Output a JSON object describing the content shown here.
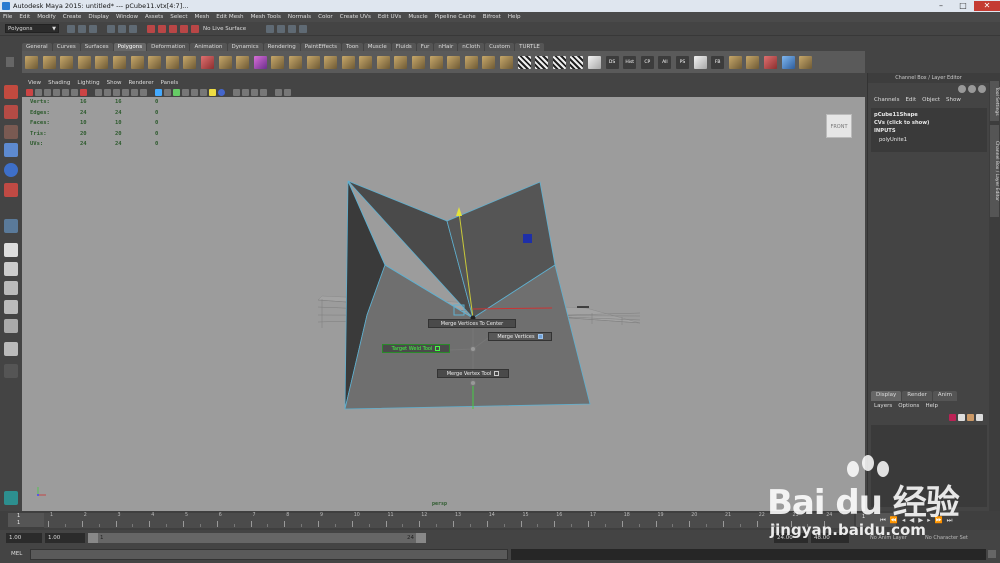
{
  "window": {
    "title": "Autodesk Maya 2015: untitled*   ---   pCube11.vtx[4:7]..."
  },
  "menubar": {
    "items": [
      "File",
      "Edit",
      "Modify",
      "Create",
      "Display",
      "Window",
      "Assets",
      "Select",
      "Mesh",
      "Edit Mesh",
      "Mesh Tools",
      "Normals",
      "Color",
      "Create UVs",
      "Edit UVs",
      "Muscle",
      "Pipeline Cache",
      "Bifrost",
      "Help"
    ]
  },
  "statusline": {
    "mode": "Polygons",
    "live_surface": "No Live Surface"
  },
  "shelf": {
    "tabs": [
      "General",
      "Curves",
      "Surfaces",
      "Polygons",
      "Deformation",
      "Animation",
      "Dynamics",
      "Rendering",
      "PaintEffects",
      "Toon",
      "Muscle",
      "Fluids",
      "Fur",
      "nHair",
      "nCloth",
      "Custom",
      "TURTLE"
    ],
    "active_tab": "Polygons",
    "labeled_tools": [
      "DS",
      "Hist",
      "CP",
      "All",
      "PS",
      "FB"
    ]
  },
  "viewport": {
    "menu": [
      "View",
      "Shading",
      "Lighting",
      "Show",
      "Renderer",
      "Panels"
    ],
    "view_cube_label": "FRONT",
    "camera_label": "persp",
    "hud": [
      [
        "Verts:",
        "16",
        "16",
        "0"
      ],
      [
        "Edges:",
        "24",
        "24",
        "0"
      ],
      [
        "Faces:",
        "10",
        "10",
        "0"
      ],
      [
        "Tris:",
        "20",
        "20",
        "0"
      ],
      [
        "UVs:",
        "24",
        "24",
        "0"
      ]
    ],
    "marking_menu": {
      "north": "Merge Vertices To Center",
      "east": "Merge Vertices",
      "west": "Target Weld Tool",
      "south": "Merge Vertex Tool"
    }
  },
  "channel_box": {
    "header": "Channel Box / Layer Editor",
    "menu": [
      "Channels",
      "Edit",
      "Object",
      "Show"
    ],
    "shape_name": "pCube11Shape",
    "cvs_hint": "CVs (click to show)",
    "inputs_label": "INPUTS",
    "input_node": "polyUnite1"
  },
  "layer_editor": {
    "tabs": [
      "Display",
      "Render",
      "Anim"
    ],
    "active_tab": "Display",
    "menu": [
      "Layers",
      "Options",
      "Help"
    ]
  },
  "side_tabs": [
    "Tool Settings",
    "Channel Box / Layer Editor"
  ],
  "timeline": {
    "current_frame": "1",
    "current_frame_sub": "1",
    "tick_labels": [
      "1",
      "2",
      "3",
      "4",
      "5",
      "6",
      "7",
      "8",
      "9",
      "10",
      "11",
      "12",
      "13",
      "14",
      "15",
      "16",
      "17",
      "18",
      "19",
      "20",
      "21",
      "22",
      "23",
      "24"
    ],
    "right_field": "1"
  },
  "range": {
    "start": "1.00",
    "anim_start": "1.00",
    "slider_start": "1",
    "slider_end": "24",
    "end": "24.00",
    "anim_end": "48.00",
    "anim_layer": "No Anim Layer",
    "char_set": "No Character Set"
  },
  "command_line": {
    "label": "MEL"
  },
  "watermark": {
    "brand": "Bai du 经验",
    "url": "jingyan.baidu.com"
  },
  "colors": {
    "viewport_bg": "#9c9c9c",
    "hud_text": "#2c5a2c",
    "mesh_dark": "#3e3e3e",
    "mesh_light": "#6f6f6f",
    "wire_selected": "#5fb0d0"
  }
}
